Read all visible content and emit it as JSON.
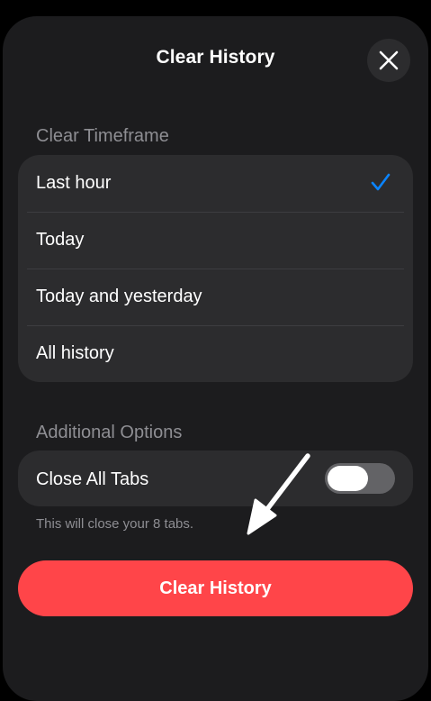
{
  "header": {
    "title": "Clear History",
    "close_icon": "close-icon"
  },
  "timeframe": {
    "section_label": "Clear Timeframe",
    "options": [
      {
        "label": "Last hour",
        "selected": true
      },
      {
        "label": "Today",
        "selected": false
      },
      {
        "label": "Today and yesterday",
        "selected": false
      },
      {
        "label": "All history",
        "selected": false
      }
    ]
  },
  "additional": {
    "section_label": "Additional Options",
    "close_all_tabs": {
      "label": "Close All Tabs",
      "enabled": false
    },
    "note": "This will close your 8 tabs."
  },
  "action": {
    "clear_label": "Clear History"
  },
  "colors": {
    "background": "#000000",
    "sheet": "#1c1c1e",
    "group": "#2c2c2e",
    "accent_check": "#0a84ff",
    "destructive": "#ff4549",
    "secondary_text": "#8e8e93"
  }
}
